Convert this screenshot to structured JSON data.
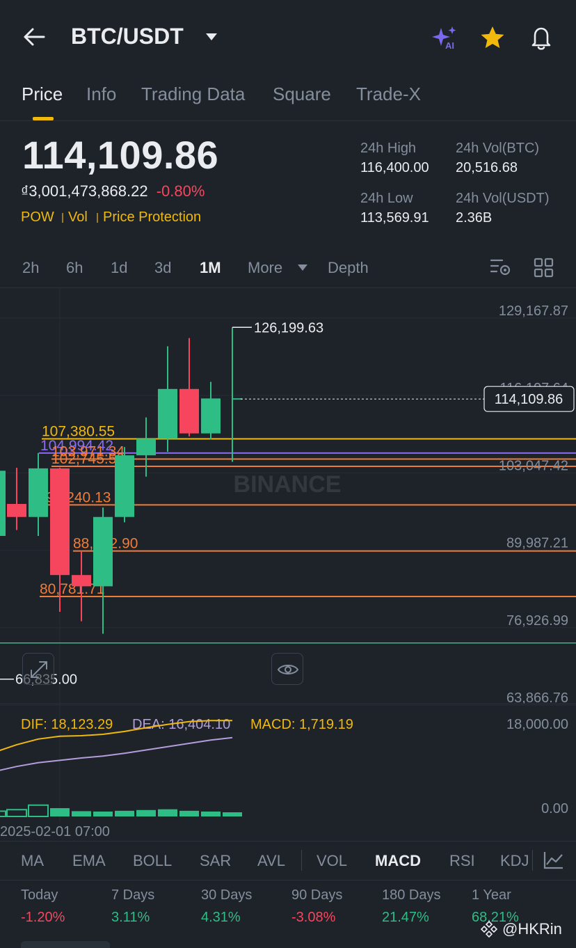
{
  "header": {
    "pair": "BTC/USDT",
    "ai_badge": "AI"
  },
  "tabs": [
    {
      "label": "Price",
      "active": true
    },
    {
      "label": "Info"
    },
    {
      "label": "Trading Data"
    },
    {
      "label": "Square"
    },
    {
      "label": "Trade-X"
    }
  ],
  "ticker": {
    "last_price": "114,109.86",
    "fiat_price": "₫3,001,473,868.22",
    "change_pct": "-0.80%",
    "tags": [
      "POW",
      "Vol",
      "Price Protection"
    ],
    "high_24h_label": "24h High",
    "high_24h": "116,400.00",
    "low_24h_label": "24h Low",
    "low_24h": "113,569.91",
    "vol_btc_label": "24h Vol(BTC)",
    "vol_btc": "20,516.68",
    "vol_usdt_label": "24h Vol(USDT)",
    "vol_usdt": "2.36B"
  },
  "timeframes": {
    "items": [
      "2h",
      "6h",
      "1d",
      "3d",
      "1M"
    ],
    "active": "1M",
    "more_label": "More",
    "depth_label": "Depth"
  },
  "chart_data": {
    "type": "candlestick",
    "interval": "1M",
    "watermark": "BINANCE",
    "y_axis_ticks": [
      "129,167.87",
      "116,107.64",
      "103,047.42",
      "89,987.21",
      "76,926.99",
      "63,866.76"
    ],
    "current_price_label": "114,109.86",
    "high_marker": "126,199.63",
    "low_marker": "66,835.00",
    "candles": [
      {
        "open": 91000,
        "close": 102000,
        "high": 105000,
        "low": 67000,
        "dir": "up"
      },
      {
        "open": 96400,
        "close": 94200,
        "high": 102500,
        "low": 92000,
        "dir": "down"
      },
      {
        "open": 94200,
        "close": 102400,
        "high": 105000,
        "low": 91000,
        "dir": "up"
      },
      {
        "open": 102400,
        "close": 84400,
        "high": 102500,
        "low": 78200,
        "dir": "down"
      },
      {
        "open": 84400,
        "close": 82500,
        "high": 88500,
        "low": 76600,
        "dir": "down"
      },
      {
        "open": 82500,
        "close": 94200,
        "high": 95800,
        "low": 74500,
        "dir": "up"
      },
      {
        "open": 94200,
        "close": 104600,
        "high": 106000,
        "low": 93300,
        "dir": "up"
      },
      {
        "open": 104600,
        "close": 107400,
        "high": 111000,
        "low": 101000,
        "dir": "up"
      },
      {
        "open": 107400,
        "close": 115800,
        "high": 123000,
        "low": 105200,
        "dir": "up"
      },
      {
        "open": 115800,
        "close": 108300,
        "high": 124400,
        "low": 107800,
        "dir": "down"
      },
      {
        "open": 108300,
        "close": 114200,
        "high": 117000,
        "low": 107300,
        "dir": "up"
      },
      {
        "open": 114100,
        "close": 114110,
        "high": 126199.63,
        "low": 103500,
        "dir": "up"
      }
    ],
    "levels": [
      {
        "label": "107,380.55",
        "value": 107380.55,
        "color": "#f0b90b"
      },
      {
        "label": "104,994.42",
        "value": 104994.42,
        "color": "#8b6cf0"
      },
      {
        "label": "103,971.34",
        "value": 103971.34,
        "color": "#f07c3a"
      },
      {
        "label": "102,745.58",
        "value": 102745.58,
        "color": "#f07c3a"
      },
      {
        "label": "96,240.13",
        "value": 96240.13,
        "color": "#f07c3a"
      },
      {
        "label": "88,452.90",
        "value": 88452.9,
        "color": "#f07c3a"
      },
      {
        "label": "80,781.71",
        "value": 80781.71,
        "color": "#f07c3a"
      }
    ],
    "macd": {
      "dif_label": "DIF: 18,123.29",
      "dea_label": "DEA: 16,404.10",
      "macd_label": "MACD: 1,719.19",
      "axis_top": "18,000.00",
      "axis_bottom": "0.00",
      "histogram": [
        700,
        900,
        1500,
        1100,
        700,
        650,
        750,
        850,
        950,
        750,
        650,
        550
      ],
      "dif": [
        11500,
        13000,
        14200,
        14800,
        14900,
        15200,
        15800,
        16600,
        17300,
        17900,
        18100,
        18123.29
      ],
      "dea": [
        9300,
        10300,
        11100,
        11600,
        12100,
        12500,
        13100,
        13800,
        14500,
        15200,
        15900,
        16404.1
      ]
    },
    "x_label": "2025-02-01 07:00"
  },
  "indicators": {
    "items": [
      "MA",
      "EMA",
      "BOLL",
      "SAR",
      "AVL",
      "VOL",
      "MACD",
      "RSI",
      "KDJ"
    ],
    "active": "MACD"
  },
  "performance": [
    {
      "label": "Today",
      "value": "-1.20%",
      "dir": "neg"
    },
    {
      "label": "7 Days",
      "value": "3.11%",
      "dir": "pos"
    },
    {
      "label": "30 Days",
      "value": "4.31%",
      "dir": "pos"
    },
    {
      "label": "90 Days",
      "value": "-3.08%",
      "dir": "neg"
    },
    {
      "label": "180 Days",
      "value": "21.47%",
      "dir": "pos"
    },
    {
      "label": "1 Year",
      "value": "68.21%",
      "dir": "pos"
    }
  ],
  "footer_watermark": "@HKRin",
  "colors": {
    "up": "#2ebd85",
    "down": "#f6465d",
    "accent": "#f0b90b",
    "background": "#1e2329"
  }
}
